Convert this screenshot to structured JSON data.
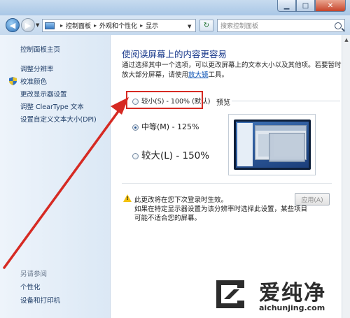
{
  "window": {
    "min_label": "▁",
    "max_label": "□",
    "close_label": "✕"
  },
  "addressbar": {
    "crumbs": [
      "控制面板",
      "外观和个性化",
      "显示"
    ],
    "separator": "▸",
    "search_placeholder": "搜索控制面板"
  },
  "sidebar": {
    "items": [
      "控制面板主页",
      "调整分辨率",
      "校准颜色",
      "更改显示器设置",
      "调整 ClearType 文本",
      "设置自定义文本大小(DPI)"
    ],
    "see_also_heading": "另请参阅",
    "see_also_items": [
      "个性化",
      "设备和打印机"
    ]
  },
  "main": {
    "title": "使阅读屏幕上的内容更容易",
    "description_prefix": "通过选择其中一个选项，可以更改屏幕上的文本大小以及其他项。若要暂时放大部分屏幕，请使用",
    "description_link": "放大镜",
    "description_suffix": "工具。",
    "preview_label": "预览",
    "options": [
      {
        "label": "较小(S) - 100% (默认)",
        "checked": false
      },
      {
        "label": "中等(M) - 125%",
        "checked": true
      },
      {
        "label": "较大(L) - 150%",
        "checked": false
      }
    ],
    "warning": "此更改将在您下次登录时生效。",
    "note": "如果在特定显示器设置为该分辨率时选择此设置，某些项目可能不适合您的屏幕。",
    "apply_label": "应用(A)"
  },
  "watermark": {
    "cn": "爱纯净",
    "en": "aichunjing.com"
  },
  "colors": {
    "accent_red": "#d62a23",
    "title_blue": "#1a3a8c",
    "link_blue": "#0a52b5"
  }
}
